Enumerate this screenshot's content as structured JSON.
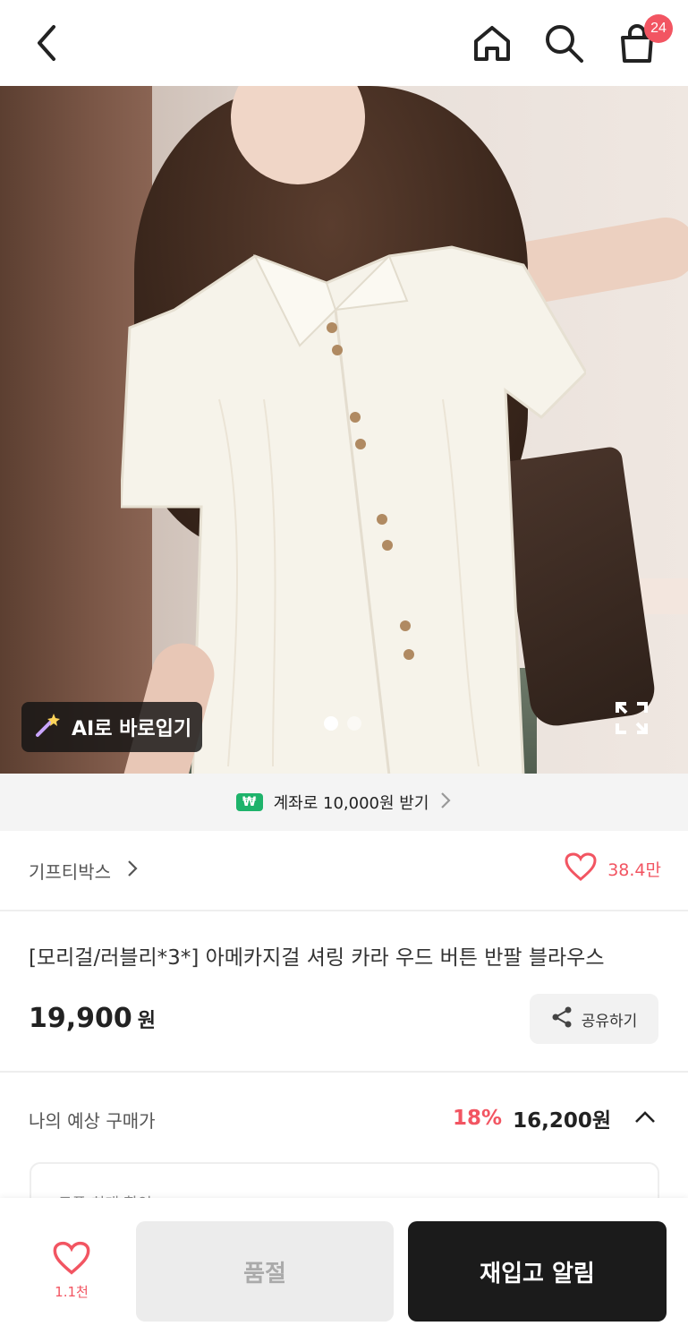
{
  "header": {
    "cart_count": "24",
    "icons": [
      "back-arrow-icon",
      "home-icon",
      "search-icon",
      "shopping-bag-icon"
    ]
  },
  "hero": {
    "ai_button_label": "AI로 바로입기",
    "ai_icon": "magic-wand-icon",
    "slide_count": 2,
    "active_slide": 1
  },
  "banner": {
    "badge": "₩",
    "text": "계좌로 10,000원 받기"
  },
  "product": {
    "brand": "기프티박스",
    "likes": "38.4만",
    "title": "[모리걸/러블리*3*] 아메카지걸 셔링 카라 우드 버튼 반팔 블라우스",
    "price": "19,900",
    "price_unit": "원",
    "share_label": "공유하기"
  },
  "expected_price": {
    "label": "나의 예상 구매가",
    "discount": "18%",
    "value": "16,200원",
    "coupon_label": "쿠폰 최대 할인"
  },
  "bottom_bar": {
    "wish_count": "1.1천",
    "soldout_label": "품절",
    "restock_label": "재입고 알림"
  },
  "colors": {
    "accent": "#f25562",
    "dark_button": "#1b1b1b",
    "won_badge": "#1eb36b"
  }
}
